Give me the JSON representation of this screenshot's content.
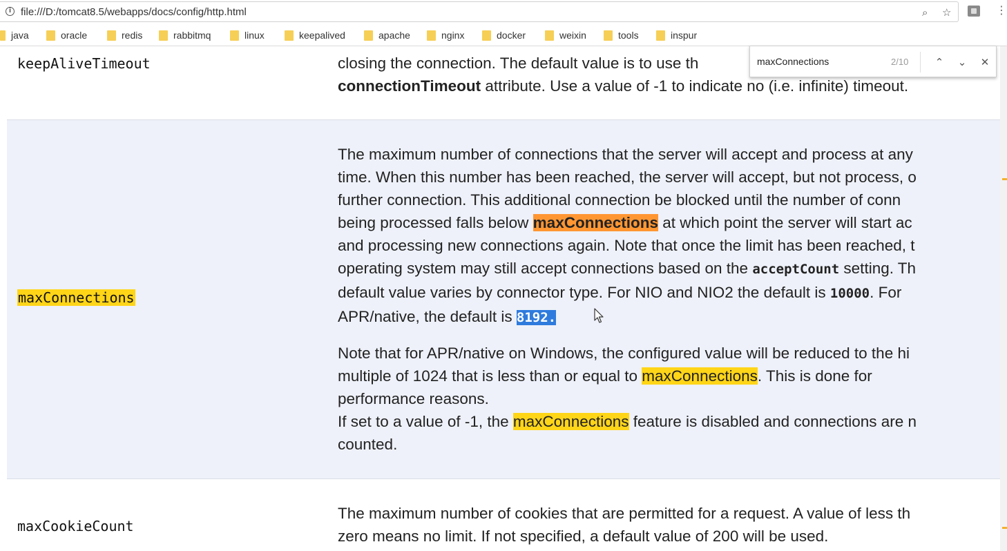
{
  "browser": {
    "url": "file:///D:/tomcat8.5/webapps/docs/config/http.html",
    "bookmarks": [
      "java",
      "oracle",
      "redis",
      "rabbitmq",
      "linux",
      "keepalived",
      "apache",
      "nginx",
      "docker",
      "weixin",
      "tools",
      "inspur"
    ],
    "icons": [
      "info-icon",
      "zoom-icon",
      "star-icon",
      "extension-icon",
      "menu-icon",
      "folder-icon"
    ]
  },
  "find_bar": {
    "query": "maxConnections",
    "count": "2/10",
    "prev_glyph": "⌃",
    "next_glyph": "⌄",
    "close_glyph": "✕"
  },
  "rows": {
    "keepalive": {
      "name": "keepAliveTimeout",
      "line1": "closing the connection. The default value is to use th",
      "line2_bold": "connectionTimeout",
      "line2_rest": " attribute. Use a value of -1 to indicate no (i.e. infinite) timeout."
    },
    "maxconn": {
      "name": "maxConnections",
      "p1": {
        "l1": "The maximum number of connections that the server will accept and process at any",
        "l2": "time. When this number has been reached, the server will accept, but not process, o",
        "l3": "further connection. This additional connection be blocked until the number of conn",
        "l4_a": "being processed falls below ",
        "l4_hl": "maxConnections",
        "l4_b": " at which point the server will start ac",
        "l5": "and processing new connections again. Note that once the limit has been reached, t",
        "l6_a": "operating system may still accept connections based on the ",
        "l6_code": "acceptCount",
        "l6_b": " setting. Th",
        "l7_a": "default value varies by connector type. For NIO and NIO2 the default is ",
        "l7_code": "10000",
        "l7_b": ". For",
        "l8_a": "APR/native, the default is ",
        "l8_sel": "8192."
      },
      "p2": {
        "l1": "Note that for APR/native on Windows, the configured value will be reduced to the hi",
        "l2_a": "multiple of 1024 that is less than or equal to ",
        "l2_hl": "maxConnections",
        "l2_b": ". This is done for",
        "l3": "performance reasons.",
        "l4_a": "If set to a value of -1, the ",
        "l4_hl": "maxConnections",
        "l4_b": " feature is disabled and connections are n",
        "l5": "counted."
      }
    },
    "maxcookie": {
      "name": "maxCookieCount",
      "l1": "The maximum number of cookies that are permitted for a request. A value of less th",
      "l2": "zero means no limit. If not specified, a default value of 200 will be used."
    }
  }
}
